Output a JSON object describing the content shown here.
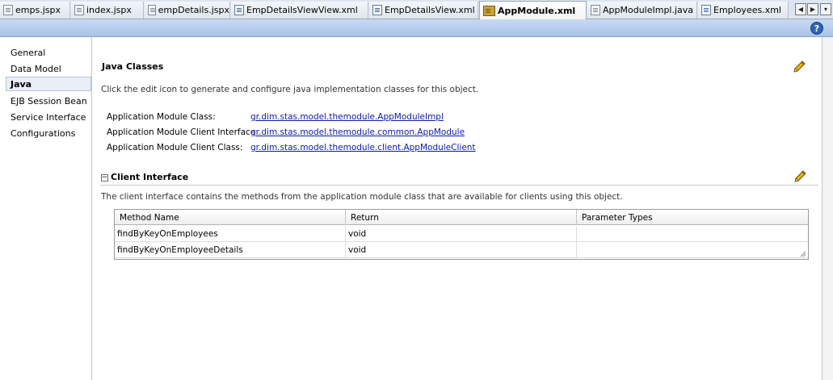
{
  "tabs": [
    {
      "label": "emps.jspx",
      "icon": "jspx-file-icon"
    },
    {
      "label": "index.jspx",
      "icon": "jspx-file-icon"
    },
    {
      "label": "empDetails.jspx",
      "icon": "jspx-file-icon"
    },
    {
      "label": "EmpDetailsViewView.xml",
      "icon": "xml-file-icon"
    },
    {
      "label": "EmpDetailsView.xml",
      "icon": "xml-file-icon"
    },
    {
      "label": "AppModule.xml",
      "icon": "app-module-icon",
      "active": true
    },
    {
      "label": "AppModuleImpl.java",
      "icon": "java-file-icon"
    },
    {
      "label": "Employees.xml",
      "icon": "xml-file-icon"
    }
  ],
  "tab_nav": {
    "prev": "◀",
    "next": "▶",
    "list": "▾"
  },
  "help": {
    "label": "?"
  },
  "sidebar": {
    "items": [
      {
        "label": "General"
      },
      {
        "label": "Data Model"
      },
      {
        "label": "Java",
        "selected": true
      },
      {
        "label": "EJB Session Bean"
      },
      {
        "label": "Service Interface"
      },
      {
        "label": "Configurations"
      }
    ]
  },
  "java_classes": {
    "title": "Java Classes",
    "description": "Click the edit icon to generate and configure java implementation classes for this object.",
    "rows": [
      {
        "label": "Application Module Class:",
        "value": "gr.dim.stas.model.themodule.AppModuleImpl"
      },
      {
        "label": "Application Module Client Interface:",
        "value": "gr.dim.stas.model.themodule.common.AppModule"
      },
      {
        "label": "Application Module Client Class:",
        "value": "gr.dim.stas.model.themodule.client.AppModuleClient"
      }
    ]
  },
  "client_interface": {
    "collapse_glyph": "−",
    "title": "Client Interface",
    "description": "The client interface contains the methods from the application module class that are available for clients using this object.",
    "columns": [
      "Method Name",
      "Return",
      "Parameter Types"
    ],
    "rows": [
      [
        "findByKeyOnEmployees",
        "void",
        ""
      ],
      [
        "findByKeyOnEmployeeDetails",
        "void",
        ""
      ]
    ]
  },
  "colors": {
    "link": "#0b1aa8",
    "header_strip": "#b8cfee",
    "pencil": "#d4a017"
  }
}
